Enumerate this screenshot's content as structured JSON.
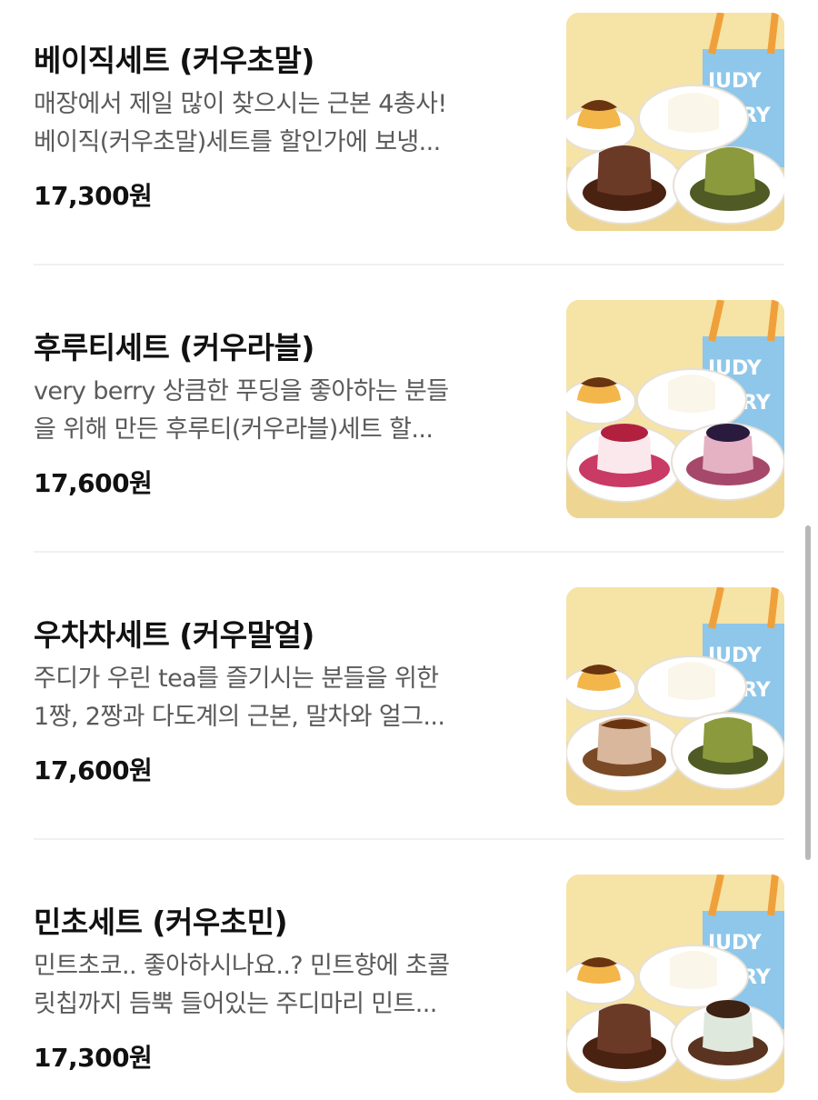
{
  "menu": {
    "items": [
      {
        "name": "베이직세트 (커우초말)",
        "desc_line1": "매장에서 제일 많이 찾으시는 근본 4총사!",
        "desc_line2": "베이직(커우초말)세트를 할인가에 보냉...",
        "price": "17,300원",
        "image_icon": "pudding-set-photo"
      },
      {
        "name": "후루티세트 (커우라블)",
        "desc_line1": "very berry 상큼한 푸딩을 좋아하는 분들",
        "desc_line2": "을 위해 만든 후루티(커우라블)세트 할...",
        "price": "17,600원",
        "image_icon": "pudding-set-photo"
      },
      {
        "name": "우차차세트 (커우말얼)",
        "desc_line1": "주디가 우린 tea를 즐기시는 분들을 위한",
        "desc_line2": "1짱, 2짱과 다도계의 근본, 말차와 얼그...",
        "price": "17,600원",
        "image_icon": "pudding-set-photo"
      },
      {
        "name": "민초세트 (커우초민)",
        "desc_line1": "민트초코.. 좋아하시나요..? 민트향에 초콜",
        "desc_line2": "릿칩까지 듬뿍 들어있는 주디마리 민트...",
        "price": "17,300원",
        "image_icon": "pudding-set-photo"
      }
    ]
  },
  "colors": {
    "text_primary": "#111111",
    "text_secondary": "#5a5a5a",
    "divider": "#f0f0f0",
    "scrollbar": "#b8b8b8"
  }
}
